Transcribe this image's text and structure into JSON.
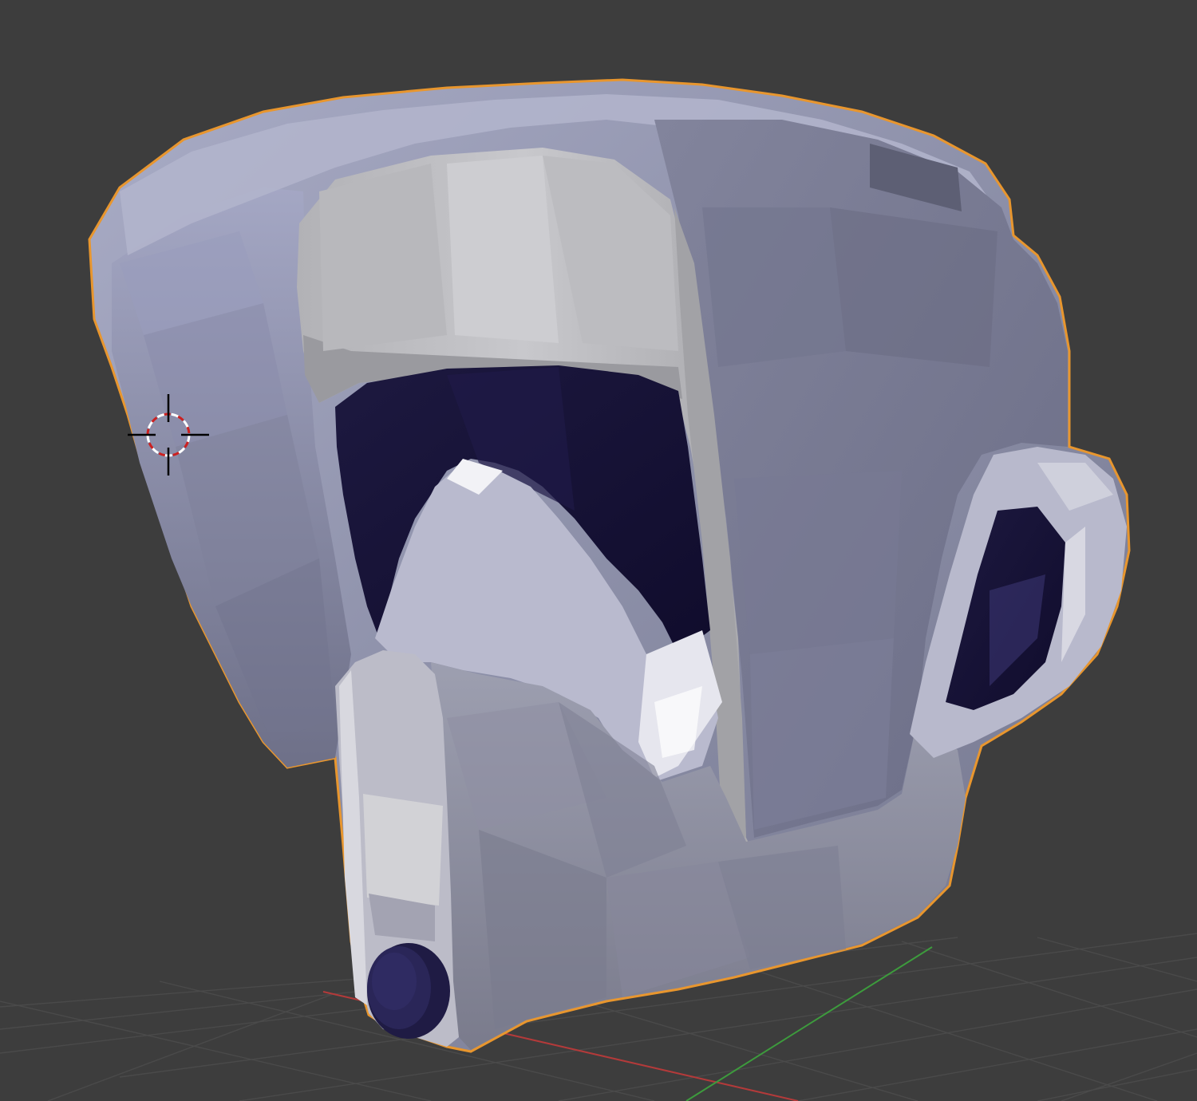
{
  "viewport": {
    "name": "3D Viewport",
    "background_color": "#3d3d3d"
  },
  "scene": {
    "object": "helmet-mesh",
    "selection_outline_color": "#e8962e",
    "shell_color": "#9ea0b8",
    "visor_color": "#16113a",
    "grid_x_axis_color": "#b33a3a",
    "grid_y_axis_color": "#3d9b3d",
    "cursor": "3d-cursor-icon"
  }
}
